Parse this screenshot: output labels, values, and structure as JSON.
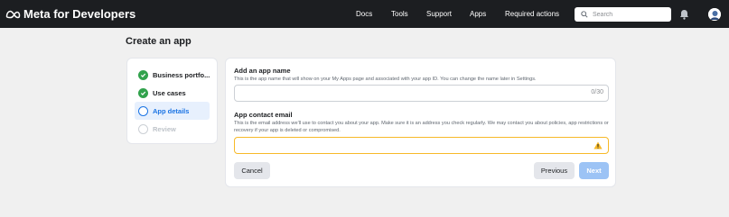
{
  "header": {
    "brand": "Meta for Developers",
    "nav": [
      {
        "label": "Docs"
      },
      {
        "label": "Tools"
      },
      {
        "label": "Support"
      },
      {
        "label": "Apps"
      },
      {
        "label": "Required actions"
      }
    ],
    "search_placeholder": "Search"
  },
  "page": {
    "title": "Create an app"
  },
  "steps": [
    {
      "label": "Business portfo...",
      "status": "done"
    },
    {
      "label": "Use cases",
      "status": "done"
    },
    {
      "label": "App details",
      "status": "current"
    },
    {
      "label": "Review",
      "status": "todo"
    }
  ],
  "form": {
    "app_name": {
      "title": "Add an app name",
      "description": "This is the app name that will show on your My Apps page and associated with your app ID. You can change the name later in Settings.",
      "value": "",
      "counter": "0/30"
    },
    "contact_email": {
      "title": "App contact email",
      "description": "This is the email address we'll use to contact you about your app. Make sure it is an address you check regularly. We may contact you about policies, app restrictions or recovery if your app is deleted or compromised.",
      "value": ""
    },
    "buttons": {
      "cancel": "Cancel",
      "previous": "Previous",
      "next": "Next"
    }
  },
  "colors": {
    "topbar": "#1c1e21",
    "accent": "#1b74e4",
    "success": "#31a24c",
    "warning": "#f7b928"
  }
}
